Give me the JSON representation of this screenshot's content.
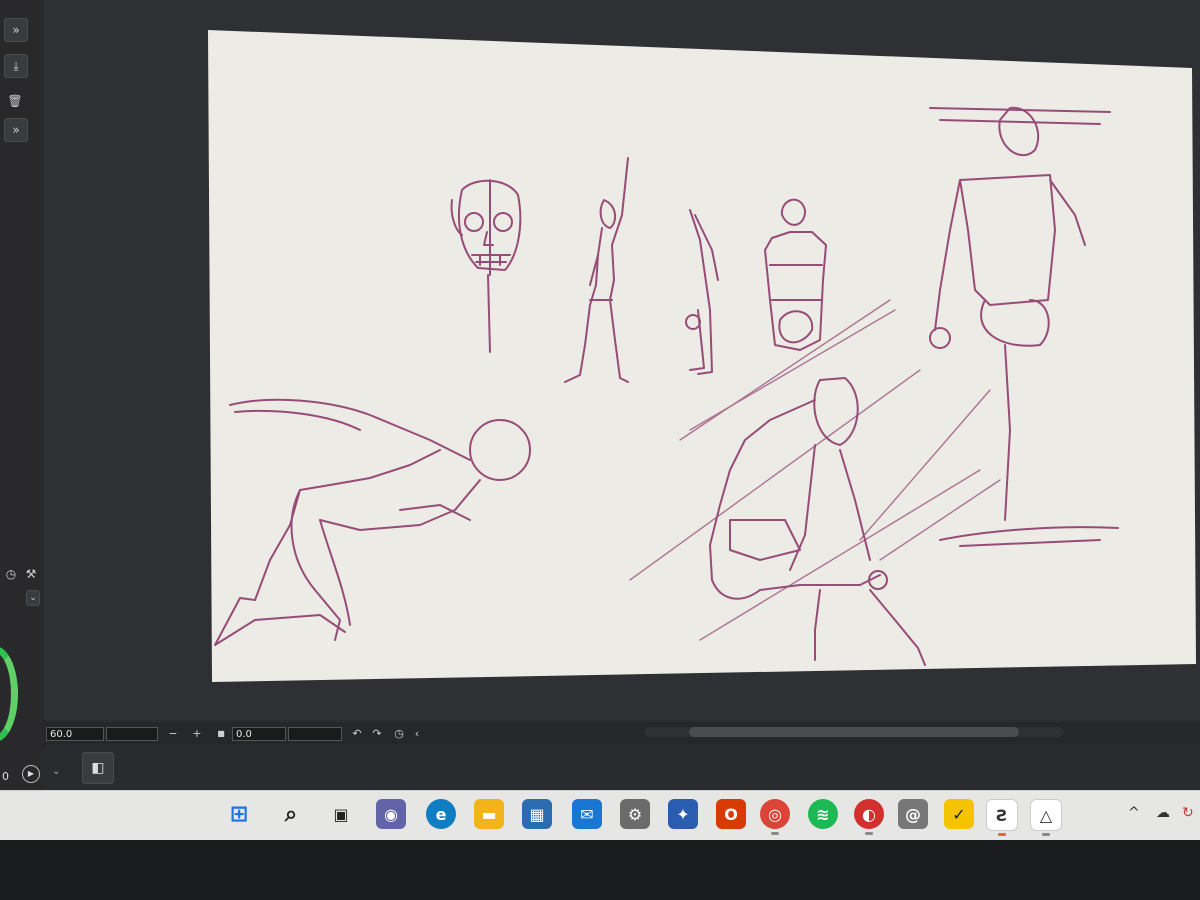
{
  "left_panel": {
    "buttons": [
      {
        "icon": "double-chevron-down-icon",
        "glyph": "»"
      },
      {
        "icon": "download-icon",
        "glyph": "⤓"
      },
      {
        "icon": "trash-icon",
        "glyph": "🗑"
      },
      {
        "icon": "double-chevron-down-icon",
        "glyph": "»"
      }
    ],
    "bottom_value": "0"
  },
  "status_bar": {
    "zoom_value": "60.0",
    "zoom_minus": "−",
    "zoom_plus": "+",
    "rotation_value": "0.0"
  },
  "taskbar": {
    "icons": [
      {
        "name": "windows-start-icon",
        "glyph": "⊞",
        "color": "#1a73e8",
        "active": false
      },
      {
        "name": "search-icon",
        "glyph": "⌕",
        "color": "#222222",
        "active": false
      },
      {
        "name": "task-view-icon",
        "glyph": "▣",
        "color": "#222222",
        "active": false
      },
      {
        "name": "teams-chat-icon",
        "glyph": "◉",
        "color": "#6264a7",
        "active": false
      },
      {
        "name": "edge-browser-icon",
        "glyph": "e",
        "color": "#0f7dc2",
        "active": false
      },
      {
        "name": "file-explorer-icon",
        "glyph": "▬",
        "color": "#f2b418",
        "active": false
      },
      {
        "name": "microsoft-store-icon",
        "glyph": "▦",
        "color": "#2b6cb0",
        "active": false
      },
      {
        "name": "mail-icon",
        "glyph": "✉",
        "color": "#1976d2",
        "active": false
      },
      {
        "name": "settings-app-icon",
        "glyph": "⚙",
        "color": "#6b6b6b",
        "active": false
      },
      {
        "name": "app-blue-icon",
        "glyph": "✦",
        "color": "#2a5db0",
        "active": false
      },
      {
        "name": "office-icon",
        "glyph": "O",
        "color": "#d83b01",
        "active": false
      },
      {
        "name": "chrome-icon",
        "glyph": "◎",
        "color": "#db4437",
        "active": true
      },
      {
        "name": "spotify-icon",
        "glyph": "≋",
        "color": "#1db954",
        "active": false
      },
      {
        "name": "antivirus-icon",
        "glyph": "◐",
        "color": "#d32f2f",
        "active": true
      },
      {
        "name": "app-spiral-icon",
        "glyph": "@",
        "color": "#777777",
        "active": false
      },
      {
        "name": "norton-check-icon",
        "glyph": "✓",
        "color": "#f5c400",
        "active": false
      },
      {
        "name": "clip-studio-icon",
        "glyph": "Ƨ",
        "color": "#333333",
        "active": true
      },
      {
        "name": "app-triangle-icon",
        "glyph": "△",
        "color": "#333333",
        "active": true
      }
    ],
    "tray": {
      "chevron_up": "^",
      "cloud": "☁"
    }
  },
  "colors": {
    "sketch_stroke": "#8e3b6b",
    "canvas_paper": "#ecebe6",
    "color_wheel": "#2fbf4f"
  }
}
